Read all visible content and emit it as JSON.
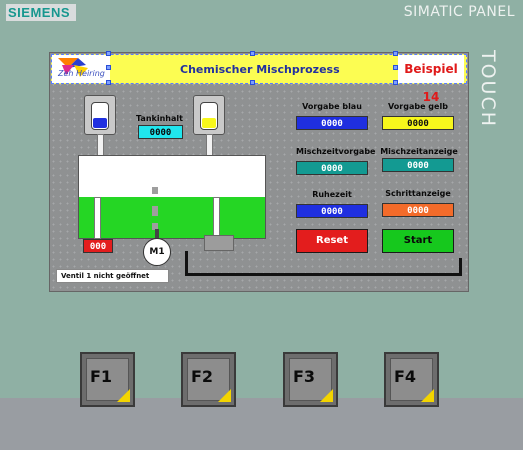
{
  "device": {
    "brand": "SIEMENS",
    "model": "SIMATIC PANEL",
    "touch_label": "TOUCH"
  },
  "screen": {
    "title": "Chemischer Mischprozess",
    "logo_text": "Zeh  Heiring",
    "example_label": "Beispiel 14",
    "tank_content_label": "Tankinhalt",
    "tank_content_value": "0000",
    "vorgabe_blau_label": "Vorgabe blau",
    "vorgabe_blau_value": "0000",
    "vorgabe_gelb_label": "Vorgabe gelb",
    "vorgabe_gelb_value": "0000",
    "mischzeitvorgabe_label": "Mischzeitvorgabe",
    "mischzeitvorgabe_value": "0000",
    "mischzeitanzeige_label": "Mischzeitanzeige",
    "mischzeitanzeige_value": "0000",
    "ruhezeit_label": "Ruhezeit",
    "ruhezeit_value": "0000",
    "schrittanzeige_label": "Schrittanzeige",
    "schrittanzeige_value": "0000",
    "reset_label": "Reset",
    "start_label": "Start",
    "motor_label": "M1",
    "counter_value": "000",
    "status_message": "Ventil 1 nicht geöffnet",
    "level_blue_fraction": 0.4,
    "level_yellow_fraction": 0.4,
    "tank_level_fraction": 0.5
  },
  "fkeys": [
    "F1",
    "F2",
    "F3",
    "F4"
  ],
  "colors": {
    "title_bg": "#fcfd52",
    "blue_field": "#1f2fe0",
    "yellow_field": "#f7f71c",
    "teal_field": "#139a92",
    "orange_field": "#f36b2a",
    "reset_button": "#e31d1d",
    "start_button": "#16c81d",
    "liquid": "#25d624"
  }
}
